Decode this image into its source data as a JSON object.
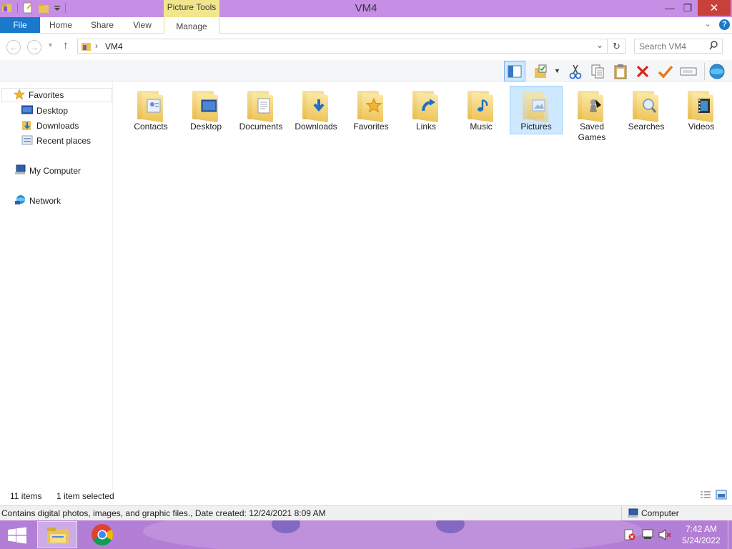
{
  "window": {
    "title": "VM4",
    "context_tab": "Picture Tools",
    "minimize_glyph": "—",
    "restore_glyph": "❐",
    "close_glyph": "✕"
  },
  "ribbon": {
    "tabs": [
      {
        "label": "File"
      },
      {
        "label": "Home"
      },
      {
        "label": "Share"
      },
      {
        "label": "View"
      },
      {
        "label": "Manage"
      }
    ],
    "expand_glyph": "⌄",
    "help_glyph": "?"
  },
  "address": {
    "back_glyph": "←",
    "forward_glyph": "→",
    "up_glyph": "↑",
    "path": "VM4",
    "separator": "›",
    "dropdown_glyph": "⌄",
    "refresh_glyph": "↻"
  },
  "search": {
    "placeholder": "Search VM4",
    "icon": "search-icon"
  },
  "navigation": {
    "favorites": "Favorites",
    "items": [
      {
        "label": "Desktop",
        "icon": "desktop-icon"
      },
      {
        "label": "Downloads",
        "icon": "downloads-icon"
      },
      {
        "label": "Recent places",
        "icon": "recent-places-icon"
      }
    ],
    "computer": "My Computer",
    "network": "Network"
  },
  "folders": [
    {
      "label": "Contacts",
      "icon": "contacts-icon",
      "selected": false
    },
    {
      "label": "Desktop",
      "icon": "desktop-icon",
      "selected": false
    },
    {
      "label": "Documents",
      "icon": "documents-icon",
      "selected": false
    },
    {
      "label": "Downloads",
      "icon": "download-arrow-icon",
      "selected": false
    },
    {
      "label": "Favorites",
      "icon": "star-icon",
      "selected": false
    },
    {
      "label": "Links",
      "icon": "link-arrow-icon",
      "selected": false
    },
    {
      "label": "Music",
      "icon": "music-note-icon",
      "selected": false
    },
    {
      "label": "Pictures",
      "icon": "picture-icon",
      "selected": true
    },
    {
      "label": "Saved Games",
      "icon": "chess-icon",
      "selected": false
    },
    {
      "label": "Searches",
      "icon": "magnifier-icon",
      "selected": false
    },
    {
      "label": "Videos",
      "icon": "film-icon",
      "selected": false
    }
  ],
  "status": {
    "item_count": "11 items",
    "selection": "1 item selected"
  },
  "details": {
    "text": "Contains digital photos, images, and graphic files., Date created: 12/24/2021 8:09 AM",
    "location": "Computer"
  },
  "taskbar": {
    "time": "7:42 AM",
    "date": "5/24/2022"
  },
  "colors": {
    "titlebar": "#c78ee6",
    "accent": "#1979ca",
    "close": "#c7403a",
    "context_tab": "#f1e68c",
    "selection": "#cde8ff",
    "taskbar": "#b37fd6"
  }
}
